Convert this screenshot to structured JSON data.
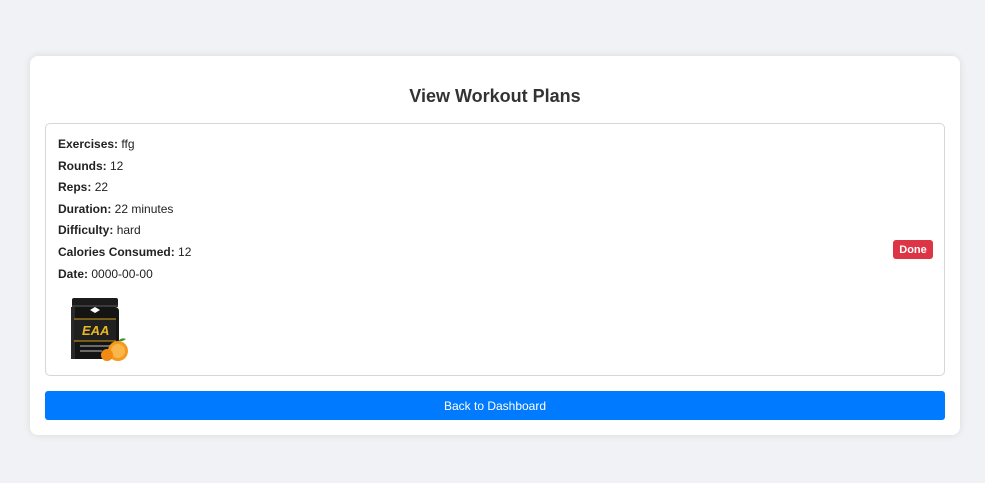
{
  "page": {
    "title": "View Workout Plans",
    "back_button": "Back to Dashboard"
  },
  "plan": {
    "fields": [
      {
        "label": "Exercises:",
        "value": "ffg"
      },
      {
        "label": "Rounds:",
        "value": "12"
      },
      {
        "label": "Reps:",
        "value": "22"
      },
      {
        "label": "Duration:",
        "value": "22 minutes"
      },
      {
        "label": "Difficulty:",
        "value": "hard"
      },
      {
        "label": "Calories Consumed:",
        "value": "12"
      },
      {
        "label": "Date:",
        "value": "0000-00-00"
      }
    ],
    "done_button": "Done",
    "image_icon": "supplement-product-image",
    "image_text": "EAA"
  },
  "colors": {
    "background": "#f0f2f5",
    "done_button": "#dc3545",
    "back_button": "#007bff"
  }
}
